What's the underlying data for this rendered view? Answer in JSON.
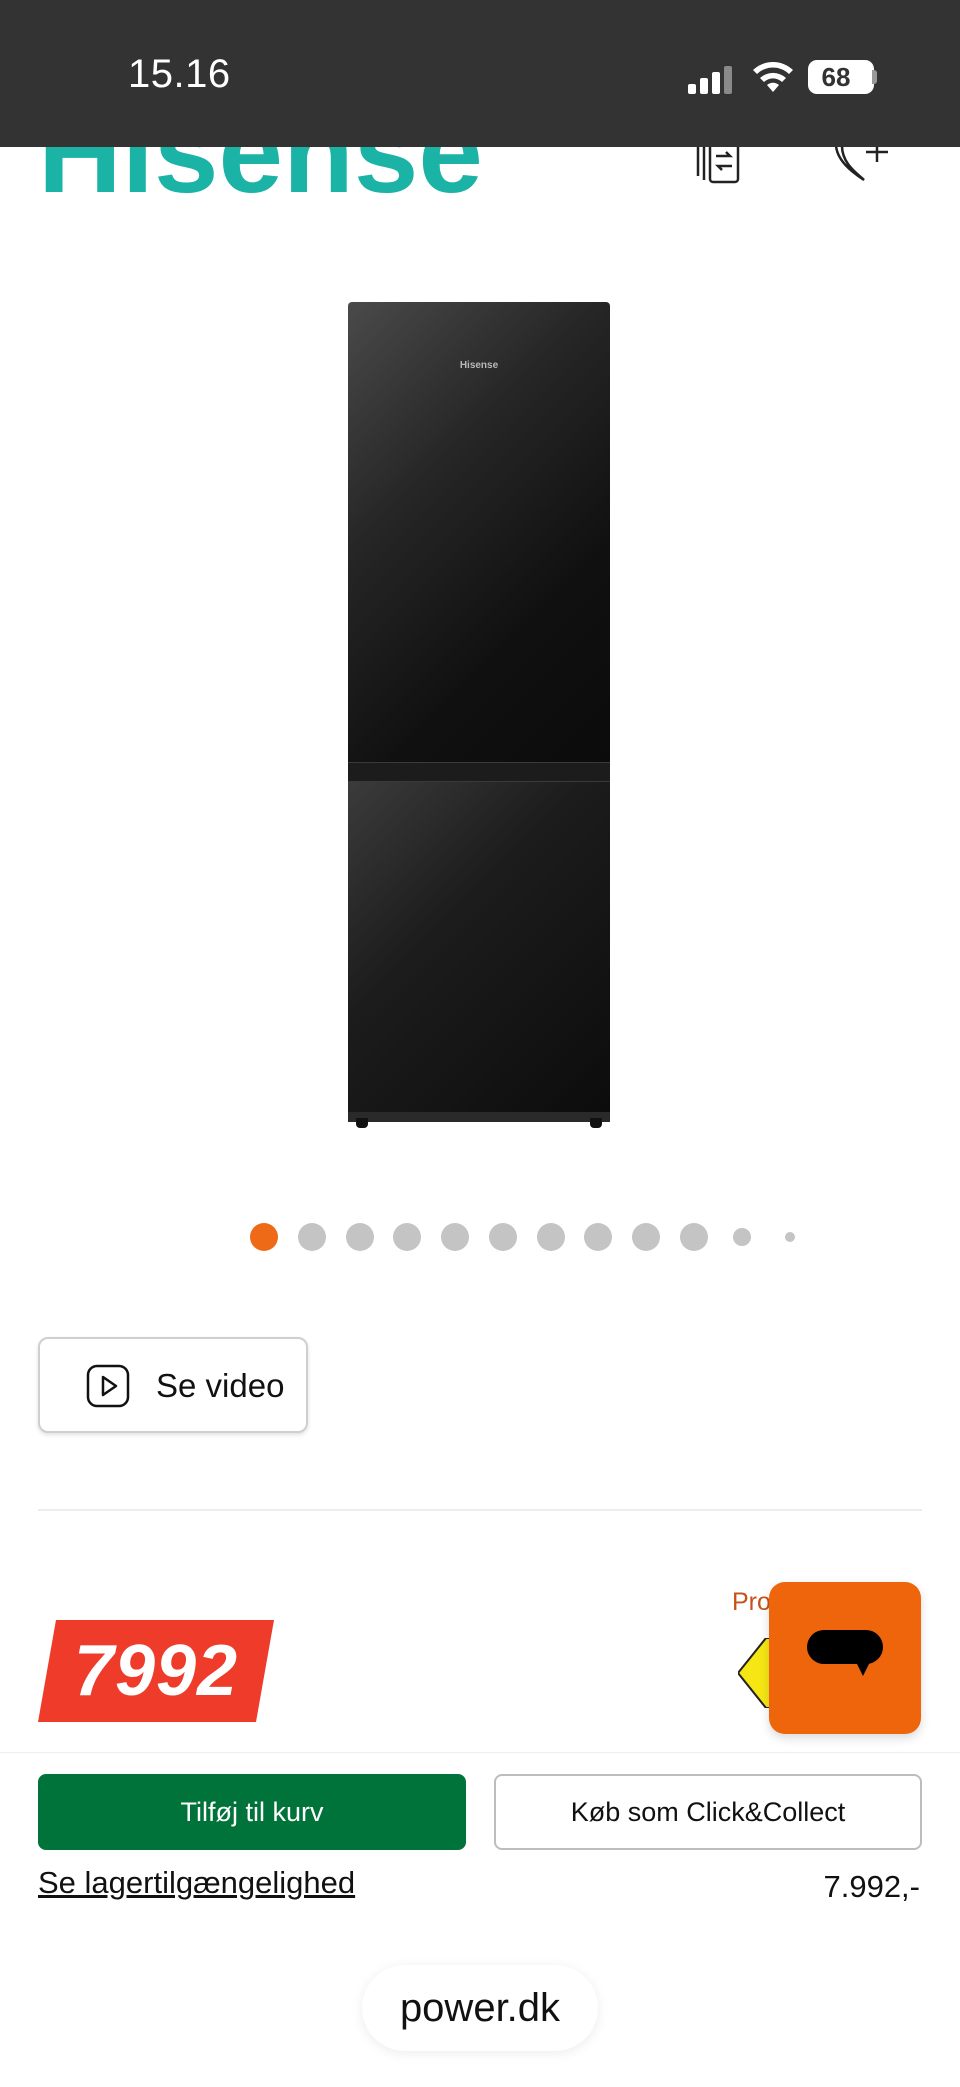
{
  "status_bar": {
    "time": "15.16",
    "battery": "68"
  },
  "header": {
    "brand": "Hisense",
    "brand_color": "#1ab3a6",
    "icons": [
      "compare-icon",
      "favorite-icon"
    ]
  },
  "product": {
    "image_logo": "Hisense",
    "carousel": {
      "total_dots": 12,
      "active_index": 0
    }
  },
  "video_button": {
    "label": "Se video",
    "icon": "play-icon"
  },
  "price": {
    "value": "7992",
    "badge_color": "#ee3b2a",
    "promo_label": "Pro"
  },
  "chat": {
    "icon": "chat-icon",
    "color": "#ee650c"
  },
  "actions": {
    "add_to_cart": "Tilføj til kurv",
    "click_collect": "Køb som Click&Collect",
    "stock_link": "Se lagertilgængelighed",
    "price": "7.992,-",
    "primary_color": "#00733a"
  },
  "browser": {
    "url": "power.dk"
  }
}
